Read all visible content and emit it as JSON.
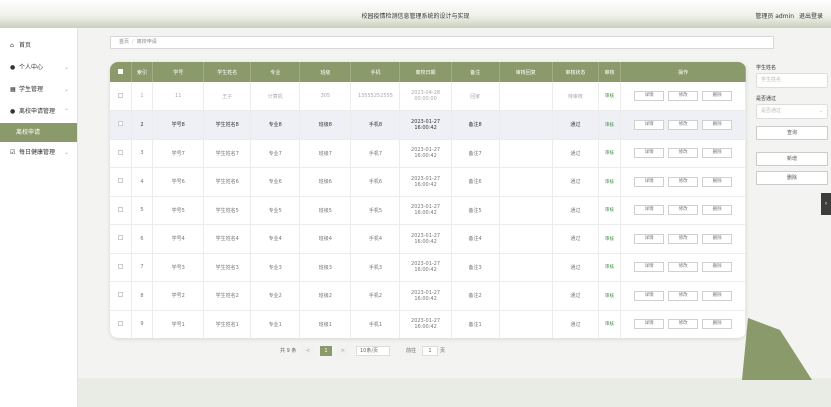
{
  "header": {
    "title": "校园疫情检测信息管理系统的设计与实现",
    "user_label": "管理员 admin",
    "logout_label": "退出登录"
  },
  "sidebar": {
    "items": [
      {
        "label": "首页",
        "icon": "home-icon",
        "has_arrow": false
      },
      {
        "label": "个人中心",
        "icon": "user-icon",
        "has_arrow": true
      },
      {
        "label": "学生管理",
        "icon": "grid-icon",
        "has_arrow": true
      },
      {
        "label": "离校申请管理",
        "icon": "user-icon",
        "has_arrow": true
      },
      {
        "label": "离校申请",
        "sub": true,
        "active": true
      },
      {
        "label": "每日健康管理",
        "icon": "check-icon",
        "has_arrow": true
      }
    ]
  },
  "breadcrumb": {
    "home": "首页",
    "separator": "/",
    "current": "离校申请"
  },
  "table": {
    "columns": [
      "索引",
      "学号",
      "学生姓名",
      "专业",
      "班级",
      "手机",
      "离校日期",
      "备注",
      "审核回复",
      "审核状态",
      "审核",
      "操作"
    ],
    "audit_link": "审核",
    "actions": [
      "详情",
      "修改",
      "删除"
    ],
    "rows": [
      {
        "index": "1",
        "xuehao": "11",
        "name": "王子",
        "major": "计算机",
        "banji": "305",
        "phone": "13555252555",
        "date": "2023-04-28 00:00:00",
        "note": "回家",
        "reply": "",
        "status": "待审核",
        "faded": true
      },
      {
        "index": "2",
        "xuehao": "学号8",
        "name": "学生姓名8",
        "major": "专业8",
        "banji": "班级8",
        "phone": "手机8",
        "date": "2023-01-27 16:00:42",
        "note": "备注8",
        "reply": "",
        "status": "通过",
        "hover": true
      },
      {
        "index": "3",
        "xuehao": "学号7",
        "name": "学生姓名7",
        "major": "专业7",
        "banji": "班级7",
        "phone": "手机7",
        "date": "2023-01-27 16:00:42",
        "note": "备注7",
        "reply": "",
        "status": "通过"
      },
      {
        "index": "4",
        "xuehao": "学号6",
        "name": "学生姓名6",
        "major": "专业6",
        "banji": "班级6",
        "phone": "手机6",
        "date": "2023-01-27 16:00:42",
        "note": "备注6",
        "reply": "",
        "status": "通过"
      },
      {
        "index": "5",
        "xuehao": "学号5",
        "name": "学生姓名5",
        "major": "专业5",
        "banji": "班级5",
        "phone": "手机5",
        "date": "2023-01-27 16:00:42",
        "note": "备注5",
        "reply": "",
        "status": "通过"
      },
      {
        "index": "6",
        "xuehao": "学号4",
        "name": "学生姓名4",
        "major": "专业4",
        "banji": "班级4",
        "phone": "手机4",
        "date": "2023-01-27 16:00:42",
        "note": "备注4",
        "reply": "",
        "status": "通过"
      },
      {
        "index": "7",
        "xuehao": "学号3",
        "name": "学生姓名3",
        "major": "专业3",
        "banji": "班级3",
        "phone": "手机3",
        "date": "2023-01-27 16:00:42",
        "note": "备注3",
        "reply": "",
        "status": "通过"
      },
      {
        "index": "8",
        "xuehao": "学号2",
        "name": "学生姓名2",
        "major": "专业2",
        "banji": "班级2",
        "phone": "手机2",
        "date": "2023-01-27 16:00:42",
        "note": "备注2",
        "reply": "",
        "status": "通过"
      },
      {
        "index": "9",
        "xuehao": "学号1",
        "name": "学生姓名1",
        "major": "专业1",
        "banji": "班级1",
        "phone": "手机1",
        "date": "2023-01-27 16:00:42",
        "note": "备注1",
        "reply": "",
        "status": "通过"
      }
    ]
  },
  "pagination": {
    "total": "共 9 条",
    "prev": "<",
    "current_page": "1",
    "next": ">",
    "page_size": "10条/页",
    "goto_label": "前往",
    "goto_value": "1",
    "page_unit": "页"
  },
  "search": {
    "name_label": "学生姓名",
    "name_placeholder": "学生姓名",
    "passed_label": "是否通过",
    "passed_placeholder": "是否通过",
    "query_button": "查询",
    "add_button": "新增",
    "delete_button": "删除"
  },
  "colors": {
    "accent": "#8b9a6a",
    "audit_link": "#3c8a3c",
    "collapse_tab": "#3d3d3d"
  }
}
